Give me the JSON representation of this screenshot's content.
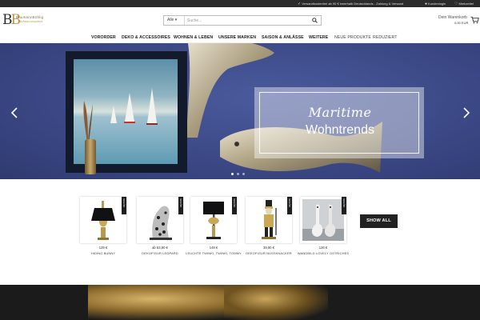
{
  "topbar": {
    "shipping": "Versandkostenfrei ab 90 € innerhalb Deutschlands - Zahlung & Versand",
    "login": "Kundenlogin",
    "wishlist": "Merkzettel"
  },
  "logo": {
    "monogram": "B",
    "name": "BaumannBöhlig",
    "tagline": "Wohnaccessoires"
  },
  "search": {
    "category": "Alle ▾",
    "placeholder": "Suche..."
  },
  "cart": {
    "label": "Dein Warenkorb",
    "amount": "0,00 EUR"
  },
  "nav": {
    "items": [
      {
        "label": "VORORDER"
      },
      {
        "label": "DEKO & ACCESSOIRES"
      },
      {
        "label": "WOHNEN & LEBEN"
      },
      {
        "label": "UNSERE MARKEN"
      },
      {
        "label": "SAISON & ANLÄSSE"
      },
      {
        "label": "WEITERE"
      },
      {
        "label": "NEUE PRODUKTE"
      },
      {
        "label": "REDUZIERT"
      }
    ]
  },
  "hero": {
    "script_text": "Maritime",
    "main_text": "Wohntrends",
    "slides": 3,
    "active_slide": 1
  },
  "products": {
    "items": [
      {
        "price": "129 €",
        "name": "HIDING BUNNY",
        "tag": "SCHÖN"
      },
      {
        "price": "ab 53,90 €",
        "name": "DEKOFIGUR LEOPARD",
        "tag": "SCHÖN"
      },
      {
        "price": "149 €",
        "name": "LEUCHTE TWINKI, TWINKI, TOMMY",
        "tag": "SCHÖN"
      },
      {
        "price": "39,90 €",
        "name": "DEKOFIGUR NUSSKNACKER",
        "tag": "SCHÖN"
      },
      {
        "price": "126 €",
        "name": "WANDBILD LOVELY OSTRICHES",
        "tag": "SCHÖN"
      }
    ],
    "show_all": "SHOW ALL"
  },
  "colors": {
    "hero_wall": "#3f4e8c",
    "gold": "#b9964a",
    "dark": "#222222"
  }
}
